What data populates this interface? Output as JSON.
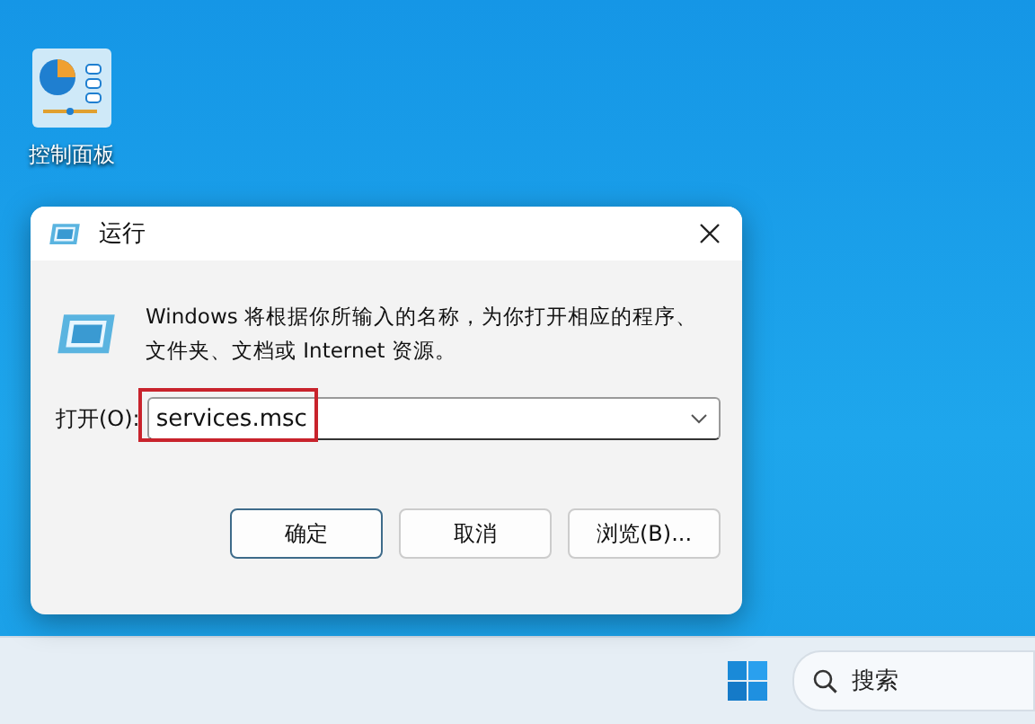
{
  "desktop_icons": [
    {
      "label": "控制面板"
    }
  ],
  "dialog": {
    "title": "运行",
    "message": "Windows 将根据你所输入的名称，为你打开相应的程序、文件夹、文档或 Internet 资源。",
    "open_label": "打开(O):",
    "open_field": {
      "value": "services.msc",
      "highlighted": true
    },
    "buttons": [
      {
        "label": "确定",
        "selected": true
      },
      {
        "label": "取消",
        "selected": false
      },
      {
        "label": "浏览(B)...",
        "selected": false
      }
    ]
  },
  "taskbar": {
    "search": {
      "placeholder": "搜索"
    }
  }
}
